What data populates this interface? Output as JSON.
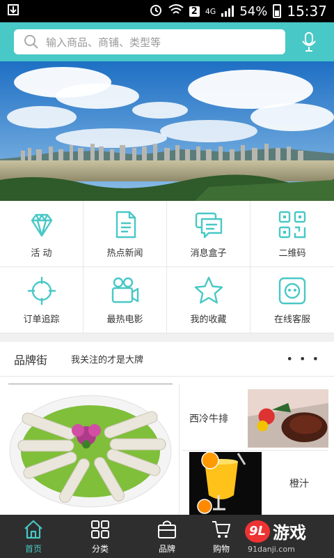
{
  "status_bar": {
    "badge": "2",
    "network": "4G",
    "battery": "54%",
    "time": "15:37"
  },
  "search": {
    "placeholder": "输入商品、商铺、类型等"
  },
  "grid": {
    "items": [
      {
        "label": "活 动",
        "icon": "diamond-icon"
      },
      {
        "label": "热点新闻",
        "icon": "document-icon"
      },
      {
        "label": "消息盒子",
        "icon": "chat-bubble-icon"
      },
      {
        "label": "二维码",
        "icon": "qr-code-icon"
      },
      {
        "label": "订单追踪",
        "icon": "crosshair-icon"
      },
      {
        "label": "最热电影",
        "icon": "video-camera-icon"
      },
      {
        "label": "我的收藏",
        "icon": "star-icon"
      },
      {
        "label": "在线客服",
        "icon": "customer-service-icon"
      }
    ]
  },
  "brand": {
    "title": "品牌街",
    "subtitle": "我关注的才是大牌",
    "more": "• • •"
  },
  "products": [
    {
      "name": "西冷牛排"
    },
    {
      "name": "橙汁"
    }
  ],
  "tabs": [
    {
      "label": "首页",
      "icon": "home-icon",
      "active": true
    },
    {
      "label": "分类",
      "icon": "grid-icon",
      "active": false
    },
    {
      "label": "品牌",
      "icon": "bag-icon",
      "active": false
    },
    {
      "label": "购物",
      "icon": "cart-icon",
      "active": false
    }
  ],
  "watermark": {
    "mark": "9L",
    "name": "游戏",
    "url": "91danji.com"
  },
  "colors": {
    "accent": "#48c8c6",
    "tabbar": "#2e2e2e"
  }
}
